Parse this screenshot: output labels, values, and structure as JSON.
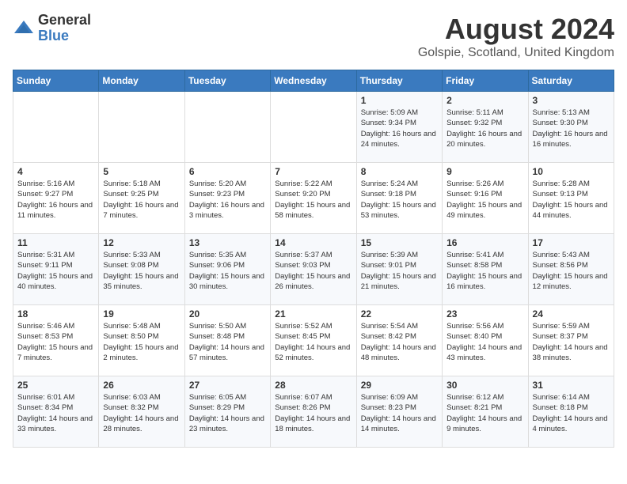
{
  "logo": {
    "general": "General",
    "blue": "Blue"
  },
  "title": "August 2024",
  "subtitle": "Golspie, Scotland, United Kingdom",
  "headers": [
    "Sunday",
    "Monday",
    "Tuesday",
    "Wednesday",
    "Thursday",
    "Friday",
    "Saturday"
  ],
  "weeks": [
    [
      {
        "day": "",
        "info": ""
      },
      {
        "day": "",
        "info": ""
      },
      {
        "day": "",
        "info": ""
      },
      {
        "day": "",
        "info": ""
      },
      {
        "day": "1",
        "info": "Sunrise: 5:09 AM\nSunset: 9:34 PM\nDaylight: 16 hours\nand 24 minutes."
      },
      {
        "day": "2",
        "info": "Sunrise: 5:11 AM\nSunset: 9:32 PM\nDaylight: 16 hours\nand 20 minutes."
      },
      {
        "day": "3",
        "info": "Sunrise: 5:13 AM\nSunset: 9:30 PM\nDaylight: 16 hours\nand 16 minutes."
      }
    ],
    [
      {
        "day": "4",
        "info": "Sunrise: 5:16 AM\nSunset: 9:27 PM\nDaylight: 16 hours\nand 11 minutes."
      },
      {
        "day": "5",
        "info": "Sunrise: 5:18 AM\nSunset: 9:25 PM\nDaylight: 16 hours\nand 7 minutes."
      },
      {
        "day": "6",
        "info": "Sunrise: 5:20 AM\nSunset: 9:23 PM\nDaylight: 16 hours\nand 3 minutes."
      },
      {
        "day": "7",
        "info": "Sunrise: 5:22 AM\nSunset: 9:20 PM\nDaylight: 15 hours\nand 58 minutes."
      },
      {
        "day": "8",
        "info": "Sunrise: 5:24 AM\nSunset: 9:18 PM\nDaylight: 15 hours\nand 53 minutes."
      },
      {
        "day": "9",
        "info": "Sunrise: 5:26 AM\nSunset: 9:16 PM\nDaylight: 15 hours\nand 49 minutes."
      },
      {
        "day": "10",
        "info": "Sunrise: 5:28 AM\nSunset: 9:13 PM\nDaylight: 15 hours\nand 44 minutes."
      }
    ],
    [
      {
        "day": "11",
        "info": "Sunrise: 5:31 AM\nSunset: 9:11 PM\nDaylight: 15 hours\nand 40 minutes."
      },
      {
        "day": "12",
        "info": "Sunrise: 5:33 AM\nSunset: 9:08 PM\nDaylight: 15 hours\nand 35 minutes."
      },
      {
        "day": "13",
        "info": "Sunrise: 5:35 AM\nSunset: 9:06 PM\nDaylight: 15 hours\nand 30 minutes."
      },
      {
        "day": "14",
        "info": "Sunrise: 5:37 AM\nSunset: 9:03 PM\nDaylight: 15 hours\nand 26 minutes."
      },
      {
        "day": "15",
        "info": "Sunrise: 5:39 AM\nSunset: 9:01 PM\nDaylight: 15 hours\nand 21 minutes."
      },
      {
        "day": "16",
        "info": "Sunrise: 5:41 AM\nSunset: 8:58 PM\nDaylight: 15 hours\nand 16 minutes."
      },
      {
        "day": "17",
        "info": "Sunrise: 5:43 AM\nSunset: 8:56 PM\nDaylight: 15 hours\nand 12 minutes."
      }
    ],
    [
      {
        "day": "18",
        "info": "Sunrise: 5:46 AM\nSunset: 8:53 PM\nDaylight: 15 hours\nand 7 minutes."
      },
      {
        "day": "19",
        "info": "Sunrise: 5:48 AM\nSunset: 8:50 PM\nDaylight: 15 hours\nand 2 minutes."
      },
      {
        "day": "20",
        "info": "Sunrise: 5:50 AM\nSunset: 8:48 PM\nDaylight: 14 hours\nand 57 minutes."
      },
      {
        "day": "21",
        "info": "Sunrise: 5:52 AM\nSunset: 8:45 PM\nDaylight: 14 hours\nand 52 minutes."
      },
      {
        "day": "22",
        "info": "Sunrise: 5:54 AM\nSunset: 8:42 PM\nDaylight: 14 hours\nand 48 minutes."
      },
      {
        "day": "23",
        "info": "Sunrise: 5:56 AM\nSunset: 8:40 PM\nDaylight: 14 hours\nand 43 minutes."
      },
      {
        "day": "24",
        "info": "Sunrise: 5:59 AM\nSunset: 8:37 PM\nDaylight: 14 hours\nand 38 minutes."
      }
    ],
    [
      {
        "day": "25",
        "info": "Sunrise: 6:01 AM\nSunset: 8:34 PM\nDaylight: 14 hours\nand 33 minutes."
      },
      {
        "day": "26",
        "info": "Sunrise: 6:03 AM\nSunset: 8:32 PM\nDaylight: 14 hours\nand 28 minutes."
      },
      {
        "day": "27",
        "info": "Sunrise: 6:05 AM\nSunset: 8:29 PM\nDaylight: 14 hours\nand 23 minutes."
      },
      {
        "day": "28",
        "info": "Sunrise: 6:07 AM\nSunset: 8:26 PM\nDaylight: 14 hours\nand 18 minutes."
      },
      {
        "day": "29",
        "info": "Sunrise: 6:09 AM\nSunset: 8:23 PM\nDaylight: 14 hours\nand 14 minutes."
      },
      {
        "day": "30",
        "info": "Sunrise: 6:12 AM\nSunset: 8:21 PM\nDaylight: 14 hours\nand 9 minutes."
      },
      {
        "day": "31",
        "info": "Sunrise: 6:14 AM\nSunset: 8:18 PM\nDaylight: 14 hours\nand 4 minutes."
      }
    ]
  ]
}
